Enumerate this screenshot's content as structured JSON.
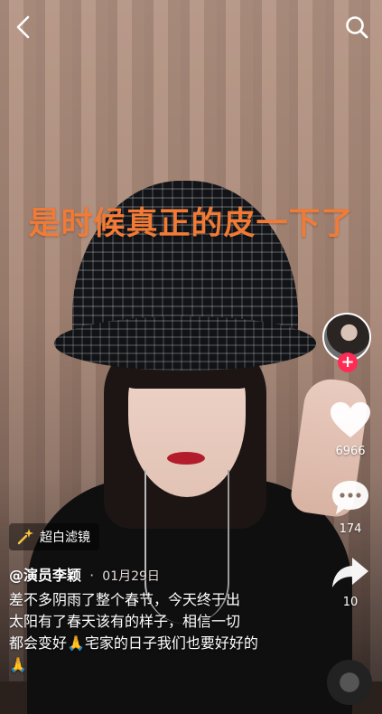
{
  "overlay": {
    "headline": "是时候真正的皮一下了"
  },
  "author": {
    "handle": "@演员李颖",
    "separator": "·",
    "date": "01月29日"
  },
  "description": {
    "line1": "差不多阴雨了整个春节，今天终于出",
    "line2": "太阳有了春天该有的样子，相信一切",
    "line3": "都会变好🙏宅家的日子我们也要好好的",
    "line4": "🙏"
  },
  "filter": {
    "label": "超白滤镜",
    "icon": "sparkle-wand-icon"
  },
  "actions": {
    "likes": "6966",
    "comments": "174",
    "shares": "10",
    "follow": "+"
  },
  "icons": {
    "back": "chevron-left-icon",
    "search": "search-icon",
    "like": "heart-icon",
    "comment": "comment-bubble-icon",
    "share": "share-arrow-icon"
  },
  "colors": {
    "headline": "#f07a36",
    "follow_badge": "#fe2c55"
  }
}
